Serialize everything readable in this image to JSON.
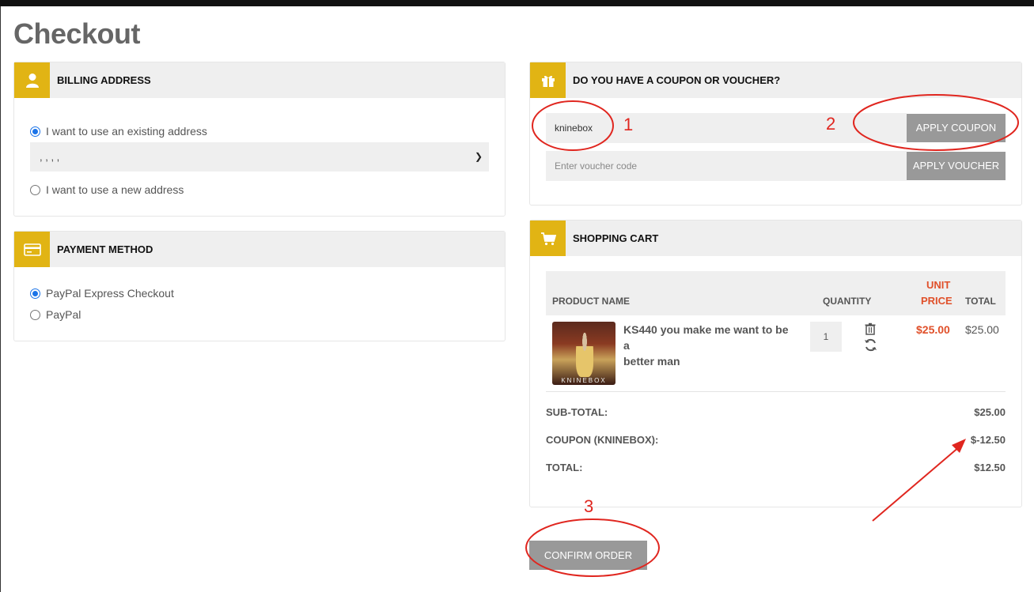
{
  "page": {
    "title": "Checkout"
  },
  "billing": {
    "title": "BILLING ADDRESS",
    "icon": "user-icon",
    "option_existing": "I want to use an existing address",
    "select_value": ", , , ,",
    "option_new": "I want to use a new address"
  },
  "payment": {
    "title": "PAYMENT METHOD",
    "icon": "credit-card-icon",
    "options": [
      "PayPal Express Checkout",
      "PayPal"
    ]
  },
  "coupon": {
    "title": "DO YOU HAVE A COUPON OR VOUCHER?",
    "icon": "gift-icon",
    "coupon_value": "kninebox",
    "apply_coupon": "APPLY COUPON",
    "voucher_placeholder": "Enter voucher code",
    "apply_voucher": "APPLY VOUCHER"
  },
  "cart": {
    "title": "SHOPPING CART",
    "icon": "shopping-cart-icon",
    "headers": {
      "product": "PRODUCT NAME",
      "quantity": "QUANTITY",
      "unit_price_1": "UNIT",
      "unit_price_2": "PRICE",
      "total": "TOTAL"
    },
    "item": {
      "name_line1": "KS440 you make me want to be a",
      "name_line2": "better man",
      "thumb_brand": "KNINEBOX",
      "quantity": "1",
      "unit_price": "$25.00",
      "total": "$25.00"
    },
    "totals": {
      "subtotal_label": "SUB-TOTAL:",
      "subtotal_value": "$25.00",
      "coupon_label": "COUPON (KNINEBOX):",
      "coupon_value": "$-12.50",
      "total_label": "TOTAL:",
      "total_value": "$12.50"
    }
  },
  "confirm": {
    "label": "CONFIRM ORDER"
  },
  "annotations": {
    "n1": "1",
    "n2": "2",
    "n3": "3"
  },
  "colors": {
    "accent": "#e1b414",
    "annotation": "#e0261f",
    "price_red": "#e0502a",
    "button_grey": "#999999"
  }
}
